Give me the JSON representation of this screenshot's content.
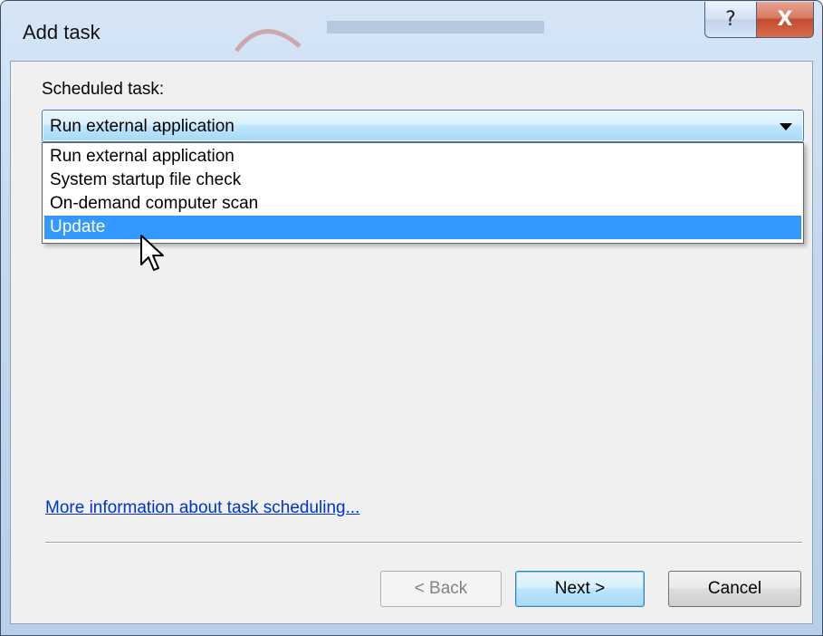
{
  "window": {
    "title": "Add task",
    "help_glyph": "?",
    "close_glyph": "X"
  },
  "form": {
    "label": "Scheduled task:",
    "selected_value": "Run external application",
    "options": [
      {
        "label": "Run external application",
        "selected": false
      },
      {
        "label": "System startup file check",
        "selected": false
      },
      {
        "label": "On-demand computer scan",
        "selected": false
      },
      {
        "label": "Update",
        "selected": true
      }
    ]
  },
  "link": {
    "text": "More information about task scheduling..."
  },
  "buttons": {
    "back": "< Back",
    "next": "Next >",
    "cancel": "Cancel"
  },
  "icons": {
    "help": "help-icon",
    "close": "close-icon",
    "dropdown_arrow": "chevron-down-icon",
    "cursor": "mouse-pointer-icon"
  },
  "colors": {
    "selection": "#3399ff",
    "link": "#0033cc",
    "close_button": "#c24b2f"
  }
}
